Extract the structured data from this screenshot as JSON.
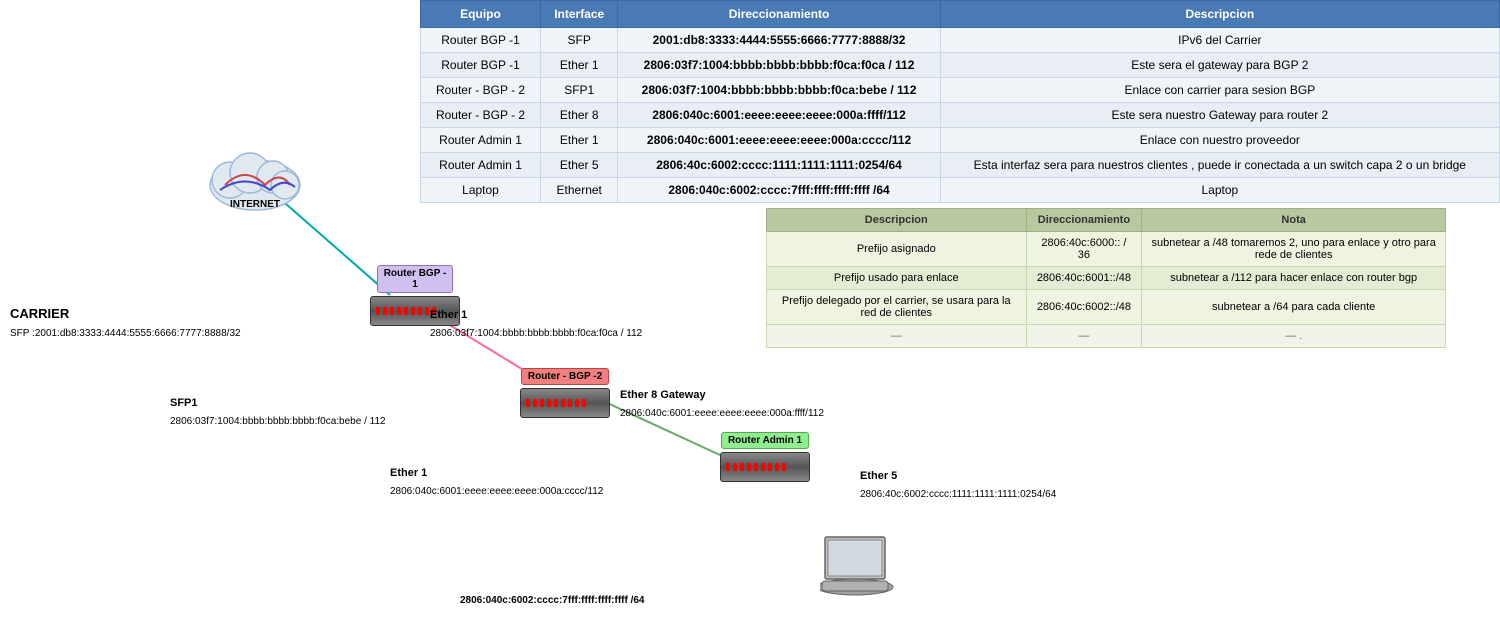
{
  "table": {
    "headers": [
      "Equipo",
      "Interface",
      "Direccionamiento",
      "Descripcion"
    ],
    "rows": [
      {
        "equipo": "Router BGP -1",
        "interface": "SFP",
        "direccionamiento": "2001:db8:3333:4444:5555:6666:7777:8888/32",
        "descripcion": "IPv6 del Carrier"
      },
      {
        "equipo": "Router BGP -1",
        "interface": "Ether 1",
        "direccionamiento": "2806:03f7:1004:bbbb:bbbb:bbbb:f0ca:f0ca / 112",
        "descripcion": "Este sera el gateway para BGP 2"
      },
      {
        "equipo": "Router - BGP - 2",
        "interface": "SFP1",
        "direccionamiento": "2806:03f7:1004:bbbb:bbbb:bbbb:f0ca:bebe / 112",
        "descripcion": "Enlace con carrier para sesion BGP"
      },
      {
        "equipo": "Router - BGP - 2",
        "interface": "Ether 8",
        "direccionamiento": "2806:040c:6001:eeee:eeee:eeee:000a:ffff/112",
        "descripcion": "Este sera nuestro Gateway para router 2"
      },
      {
        "equipo": "Router Admin 1",
        "interface": "Ether 1",
        "direccionamiento": "2806:040c:6001:eeee:eeee:eeee:000a:cccc/112",
        "descripcion": "Enlace con nuestro proveedor"
      },
      {
        "equipo": "Router Admin 1",
        "interface": "Ether 5",
        "direccionamiento": "2806:40c:6002:cccc:1111:1111:1111:0254/64",
        "descripcion": "Esta interfaz sera para nuestros clientes , puede ir conectada a un switch capa 2 o un bridge"
      },
      {
        "equipo": "Laptop",
        "interface": "Ethernet",
        "direccionamiento": "2806:040c:6002:cccc:7fff:ffff:ffff:ffff /64",
        "descripcion": "Laptop"
      }
    ]
  },
  "second_table": {
    "headers": [
      "Descripcion",
      "Direccionamiento",
      "Nota"
    ],
    "rows": [
      {
        "descripcion": "Prefijo asignado",
        "direccionamiento": "2806:40c:6000:: / 36",
        "nota": "subnetear a /48  tomaremos 2, uno para enlace y otro para rede de clientes"
      },
      {
        "descripcion": "Prefijo usado para enlace",
        "direccionamiento": "2806:40c:6001::/48",
        "nota": "subnetear a /112 para hacer enlace con router bgp"
      },
      {
        "descripcion": "Prefijo delegado por el carrier, se usara para la red de clientes",
        "direccionamiento": "2806:40c:6002::/48",
        "nota": "subnetear a /64 para cada cliente"
      },
      {
        "descripcion": "—",
        "direccionamiento": "—",
        "nota": "— ."
      }
    ]
  },
  "diagram": {
    "internet_label": "INTERNET",
    "carrier_label": "CARRIER",
    "carrier_sublabel": "SFP :2001:db8:3333:4444:5555:6666:7777:8888/32",
    "router_bgp1_label": "Router BGP -\n1",
    "router_bgp1_ether1_label": "Ether 1",
    "router_bgp1_ether1_addr": "2806:03f7:1004:bbbb:bbbb:bbbb:f0ca:f0ca / 112",
    "router_bgp2_label": "Router - BGP -2",
    "router_bgp2_sfp1_label": "SFP1",
    "router_bgp2_sfp1_addr": "2806:03f7:1004:bbbb:bbbb:bbbb:f0ca:bebe / 112",
    "router_bgp2_ether8_label": "Ether 8 Gateway",
    "router_bgp2_ether8_addr": "2806:040c:6001:eeee:eeee:eeee:000a:ffff/112",
    "router_admin1_label": "Router Admin 1",
    "router_admin1_ether1_label": "Ether 1",
    "router_admin1_ether1_addr": "2806:040c:6001:eeee:eeee:eeee:000a:cccc/112",
    "router_admin1_ether5_label": "Ether 5",
    "router_admin1_ether5_addr": "2806:40c:6002:cccc:1111:1111:1111:0254/64",
    "laptop_addr": "2806:040c:6002:cccc:7fff:ffff:ffff:ffff /64"
  }
}
